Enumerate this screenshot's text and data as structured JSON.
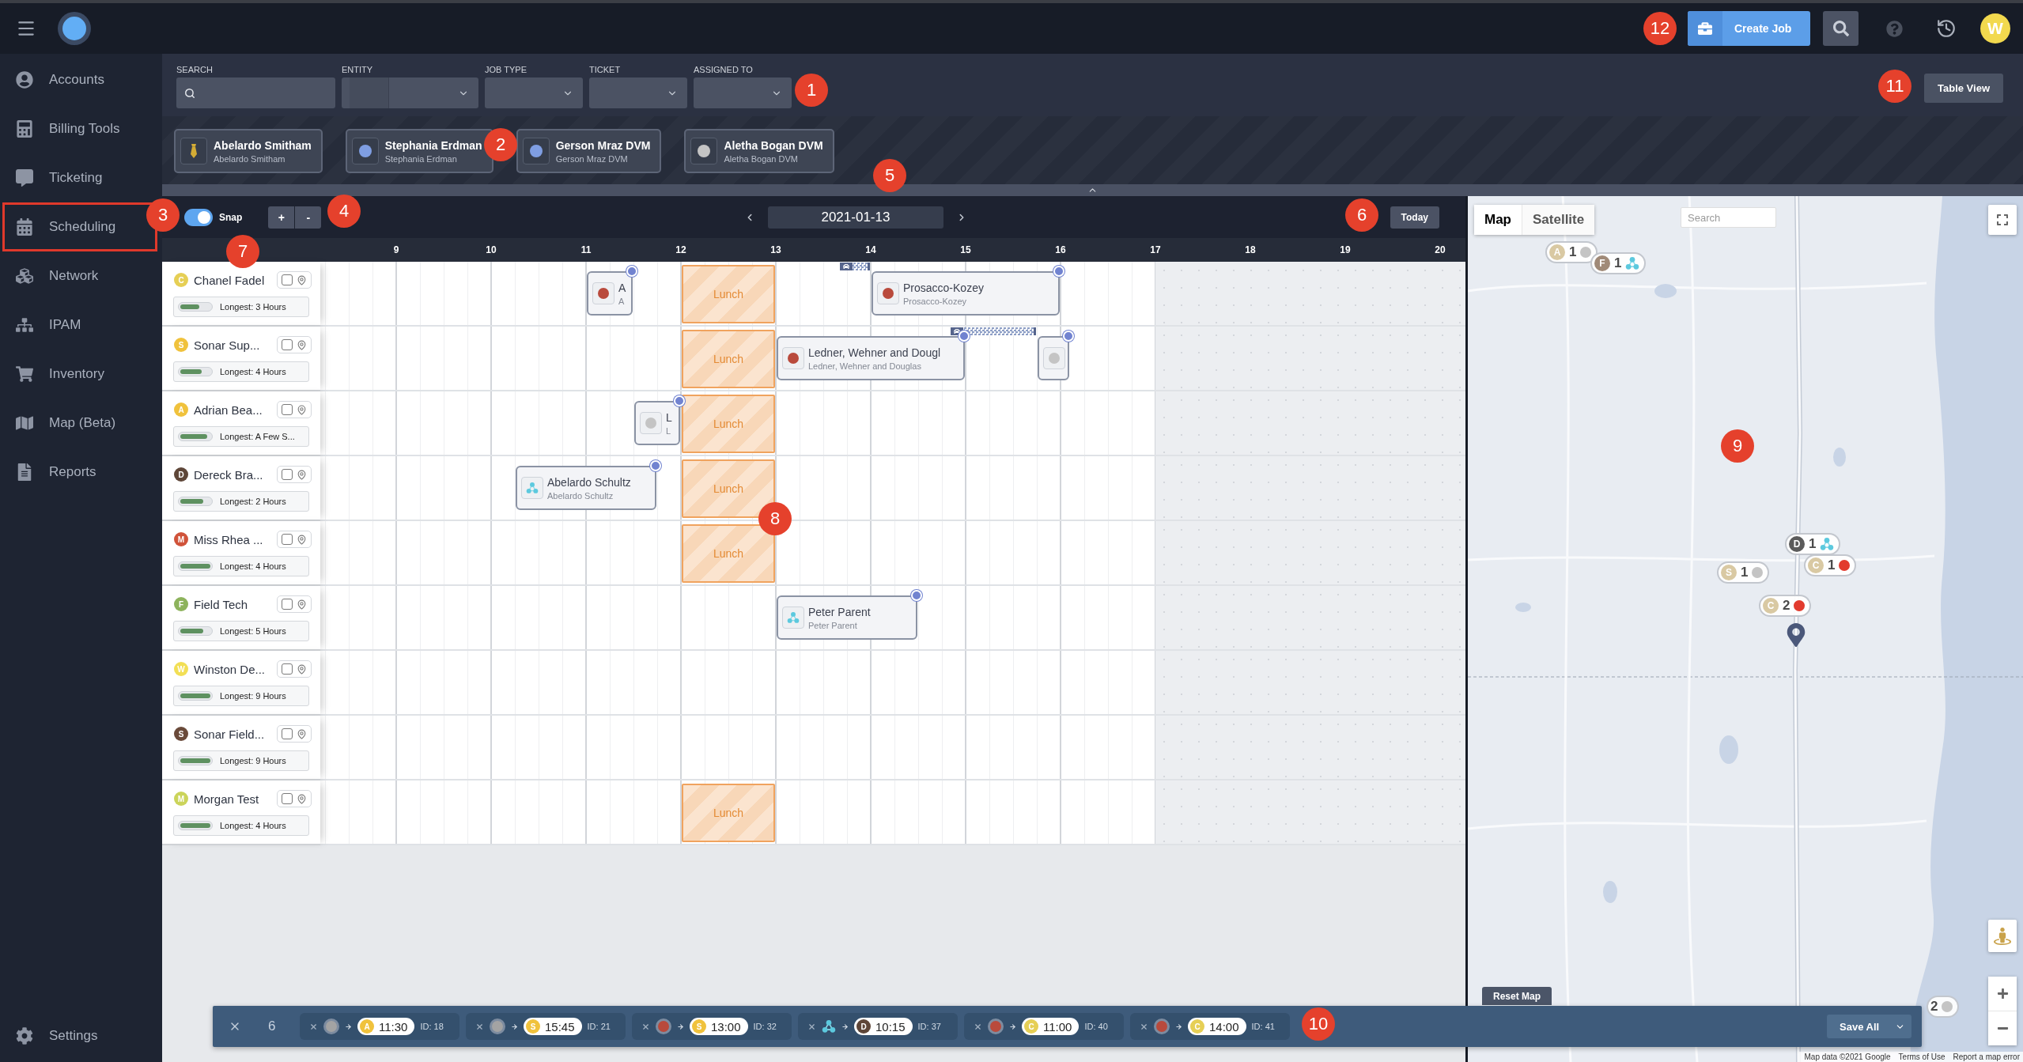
{
  "top_bar": {
    "create_job": "Create Job",
    "avatar": "W"
  },
  "sidebar": {
    "items": [
      {
        "label": "Accounts",
        "highlighted": false
      },
      {
        "label": "Billing Tools",
        "highlighted": false
      },
      {
        "label": "Ticketing",
        "highlighted": false
      },
      {
        "label": "Scheduling",
        "highlighted": true
      },
      {
        "label": "Network",
        "highlighted": false
      },
      {
        "label": "IPAM",
        "highlighted": false
      },
      {
        "label": "Inventory",
        "highlighted": false
      },
      {
        "label": "Map (Beta)",
        "highlighted": false
      },
      {
        "label": "Reports",
        "highlighted": false
      }
    ],
    "settings": "Settings"
  },
  "filters": {
    "fields": [
      {
        "label": "SEARCH",
        "kind": "search"
      },
      {
        "label": "ENTITY",
        "kind": "split"
      },
      {
        "label": "JOB TYPE",
        "kind": "select"
      },
      {
        "label": "TICKET",
        "kind": "select"
      },
      {
        "label": "ASSIGNED TO",
        "kind": "select"
      }
    ],
    "table_view": "Table View"
  },
  "entities": [
    {
      "name": "Abelardo Smitham",
      "subtitle": "Abelardo Smitham",
      "kind": "tie"
    },
    {
      "name": "Stephania Erdman",
      "subtitle": "Stephania Erdman",
      "kind": "dot",
      "color": "#7f9ee2"
    },
    {
      "name": "Gerson Mraz DVM",
      "subtitle": "Gerson Mraz DVM",
      "kind": "dot",
      "color": "#7f9ee2"
    },
    {
      "name": "Aletha Bogan DVM",
      "subtitle": "Aletha Bogan DVM",
      "kind": "dot",
      "color": "#c4c4c4"
    }
  ],
  "toolbar": {
    "snap": {
      "label": "Snap",
      "on": true
    },
    "zoom_in": "+",
    "zoom_out": "-",
    "date": "2021-01-13",
    "today": "Today"
  },
  "hours": [
    "9",
    "10",
    "11",
    "12",
    "13",
    "14",
    "15",
    "16",
    "17",
    "18",
    "19",
    "20"
  ],
  "resources": [
    {
      "initial": "C",
      "color": "#e6cf55",
      "name": "Chanel Fadel",
      "checked": false,
      "longest": "Longest: 3 Hours",
      "level": 0.62,
      "events": [
        {
          "kind": "job",
          "color": "#b94a3c",
          "title": "A",
          "subtitle": "A"
        },
        {
          "kind": "lunch",
          "label": "Lunch"
        },
        {
          "kind": "travel"
        },
        {
          "kind": "job",
          "color": "#b94a3c",
          "title": "Prosacco-Kozey",
          "subtitle": "Prosacco-Kozey"
        }
      ]
    },
    {
      "initial": "S",
      "color": "#f0c23c",
      "name": "Sonar Sup...",
      "checked": false,
      "longest": "Longest: 4 Hours",
      "level": 0.7,
      "events": [
        {
          "kind": "lunch",
          "label": "Lunch"
        },
        {
          "kind": "job",
          "color": "#b94a3c",
          "title": "Ledner, Wehner and Dougl",
          "subtitle": "Ledner, Wehner and Douglas"
        },
        {
          "kind": "travel"
        },
        {
          "kind": "job",
          "color": "#c4c4c4"
        }
      ]
    },
    {
      "initial": "A",
      "color": "#f0c23c",
      "name": "Adrian Bea...",
      "checked": false,
      "longest": "Longest: A Few S...",
      "level": 0.9,
      "events": [
        {
          "kind": "job",
          "color": "#c4c4c4",
          "title": "L",
          "subtitle": "L"
        },
        {
          "kind": "lunch",
          "label": "Lunch"
        }
      ]
    },
    {
      "initial": "D",
      "color": "#5e4638",
      "name": "Dereck Bra...",
      "checked": false,
      "longest": "Longest: 2 Hours",
      "level": 0.77,
      "events": [
        {
          "kind": "job",
          "title": "Abelardo Schultz",
          "subtitle": "Abelardo Schultz"
        },
        {
          "kind": "lunch",
          "label": "Lunch"
        }
      ]
    },
    {
      "initial": "M",
      "color": "#d0533a",
      "name": "Miss Rhea ...",
      "checked": false,
      "longest": "Longest: 4 Hours",
      "level": 1,
      "events": [
        {
          "kind": "lunch",
          "label": "Lunch"
        }
      ]
    },
    {
      "initial": "F",
      "color": "#8db35c",
      "name": "Field Tech",
      "checked": false,
      "longest": "Longest: 5 Hours",
      "level": 0.75,
      "events": [
        {
          "kind": "job",
          "title": "Peter Parent",
          "subtitle": "Peter Parent"
        }
      ]
    },
    {
      "initial": "W",
      "color": "#f2df55",
      "name": "Winston De...",
      "checked": false,
      "longest": "Longest: 9 Hours",
      "level": 1
    },
    {
      "initial": "S",
      "color": "#6a4a3a",
      "name": "Sonar Field...",
      "checked": false,
      "longest": "Longest: 9 Hours",
      "level": 1
    },
    {
      "initial": "M",
      "color": "#cbd45a",
      "name": "Morgan Test",
      "checked": false,
      "longest": "Longest: 4 Hours",
      "level": 1,
      "events": [
        {
          "kind": "lunch",
          "label": "Lunch"
        }
      ]
    }
  ],
  "selection_bar": {
    "count": "6",
    "chips": [
      {
        "color": "#a3a3a3",
        "avatar": {
          "initial": "A",
          "color": "#f0c23c"
        },
        "time": "11:30",
        "id": "ID: 18"
      },
      {
        "color": "#a3a3a3",
        "avatar": {
          "initial": "S",
          "color": "#f0c23c"
        },
        "time": "15:45",
        "id": "ID: 21"
      },
      {
        "color": "#b94a3c",
        "avatar": {
          "initial": "S",
          "color": "#f0c23c"
        },
        "time": "13:00",
        "id": "ID: 32"
      },
      {
        "avatar": {
          "initial": "D",
          "color": "#5e4638"
        },
        "time": "10:15",
        "id": "ID: 37"
      },
      {
        "color": "#b94a3c",
        "avatar": {
          "initial": "C",
          "color": "#e6cf55"
        },
        "time": "11:00",
        "id": "ID: 40"
      },
      {
        "color": "#b94a3c",
        "avatar": {
          "initial": "C",
          "color": "#e6cf55"
        },
        "time": "14:00",
        "id": "ID: 41"
      }
    ],
    "save": "Save All"
  },
  "map": {
    "types": [
      {
        "label": "Map",
        "selected": true
      },
      {
        "label": "Satellite",
        "selected": false
      }
    ],
    "search": {
      "placeholder": "Search"
    },
    "markers": [
      {
        "avatar": {
          "initial": "A",
          "color": "#d9c9a3"
        },
        "count": "1",
        "color": "#c4c4c4"
      },
      {
        "avatar": {
          "initial": "F",
          "color": "#a08a78"
        },
        "count": "1"
      },
      {
        "avatar": {
          "initial": "D",
          "color": "#5b5b5b"
        },
        "count": "1"
      },
      {
        "avatar": {
          "initial": "C",
          "color": "#d9c9a3"
        },
        "count": "1",
        "color": "#e23b2e"
      },
      {
        "avatar": {
          "initial": "S",
          "color": "#d9c9a3"
        },
        "count": "1",
        "color": "#c4c4c4"
      },
      {
        "avatar": {
          "initial": "C",
          "color": "#d9c9a3"
        },
        "count": "2",
        "color": "#e23b2e"
      },
      {
        "count": "2",
        "color": "#c4c4c4"
      }
    ],
    "reset": "Reset Map",
    "footer": [
      "Map data ©2021 Google",
      "Terms of Use",
      "Report a map error"
    ]
  },
  "callouts": [
    "1",
    "2",
    "3",
    "4",
    "5",
    "6",
    "7",
    "8",
    "9",
    "10",
    "11",
    "12"
  ]
}
